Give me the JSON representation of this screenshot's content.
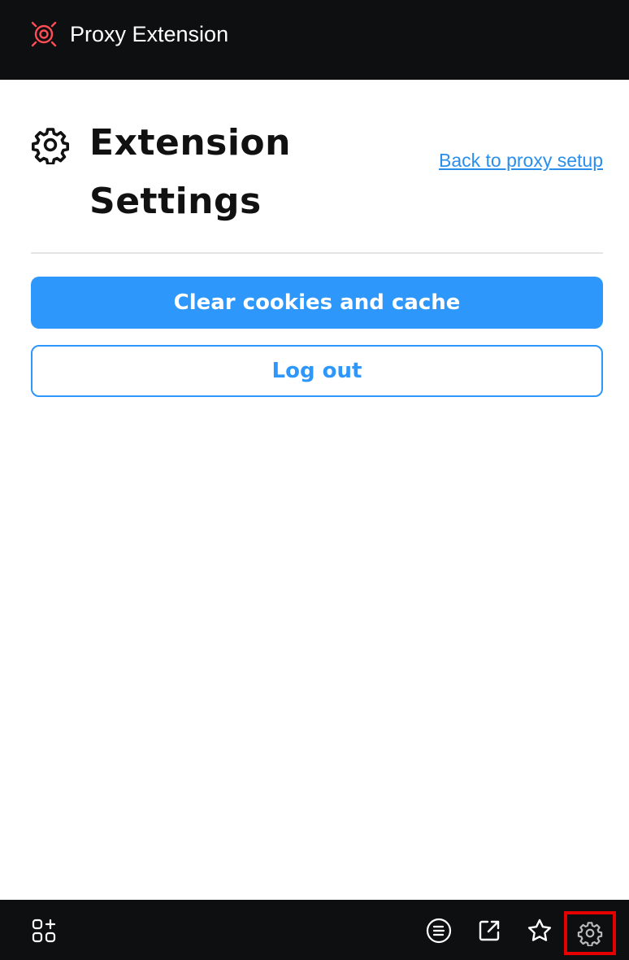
{
  "header": {
    "title": "Proxy Extension",
    "logo_icon": "radar-target-icon",
    "logo_color": "#ff4d55"
  },
  "page": {
    "title": "Extension Settings",
    "title_icon": "gear-icon",
    "back_link": "Back to proxy setup"
  },
  "actions": {
    "clear_label": "Clear cookies and cache",
    "logout_label": "Log out",
    "accent_color": "#2e97fb"
  },
  "bottom_bar": {
    "icons": [
      "apps-add-icon",
      "list-icon",
      "external-link-icon",
      "star-icon",
      "settings-gear-icon"
    ],
    "highlighted": "settings-gear-icon",
    "highlight_color": "#e60000"
  }
}
